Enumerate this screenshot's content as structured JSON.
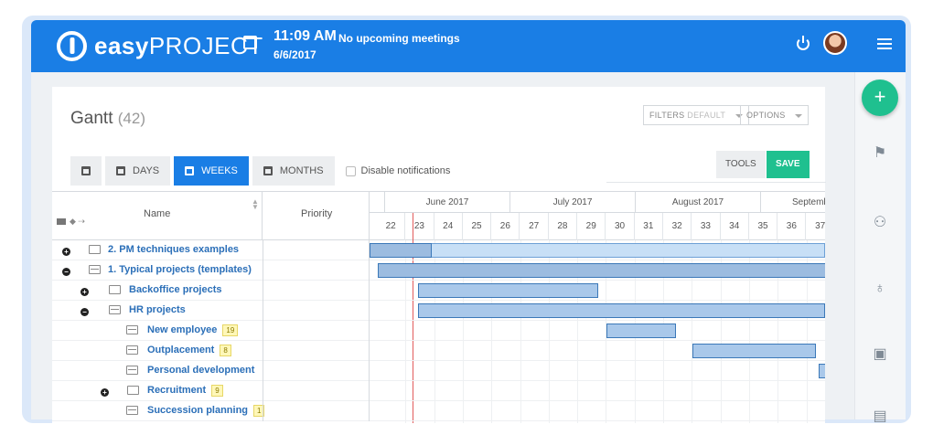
{
  "header": {
    "logo_bold": "easy",
    "logo_rest": "PROJECT",
    "time": "11:09 AM",
    "meetings": "No upcoming meetings",
    "date": "6/6/2017"
  },
  "page": {
    "title": "Gantt",
    "count": "(42)",
    "filters_label": "FILTERS",
    "filters_value": "DEFAULT",
    "options_label": "OPTIONS",
    "tools_label": "TOOLS",
    "save_label": "SAVE"
  },
  "toolbar": {
    "days": "DAYS",
    "weeks": "WEEKS",
    "months": "MONTHS",
    "disable_notifications": "Disable notifications"
  },
  "grid": {
    "col_name": "Name",
    "col_priority": "Priority",
    "months": [
      "June 2017",
      "July 2017",
      "August 2017",
      "Septemb"
    ],
    "weeks": [
      "22",
      "23",
      "24",
      "25",
      "26",
      "27",
      "28",
      "29",
      "30",
      "31",
      "32",
      "33",
      "34",
      "35",
      "36",
      "37"
    ]
  },
  "rows": [
    {
      "label": "2. PM techniques examples",
      "badge": null,
      "toggle": "+"
    },
    {
      "label": "1. Typical projects (templates)",
      "badge": null,
      "toggle": "−"
    },
    {
      "label": "Backoffice projects",
      "badge": null,
      "toggle": "+"
    },
    {
      "label": "HR projects",
      "badge": null,
      "toggle": "−"
    },
    {
      "label": "New employee",
      "badge": "19",
      "toggle": null
    },
    {
      "label": "Outplacement",
      "badge": "8",
      "toggle": null
    },
    {
      "label": "Personal development",
      "badge": null,
      "toggle": null
    },
    {
      "label": "Recruitment",
      "badge": "9",
      "toggle": "+"
    },
    {
      "label": "Succession planning",
      "badge": "1",
      "toggle": null
    }
  ],
  "colors": {
    "brand": "#1a7ee5",
    "save": "#1fc08f",
    "today_line": "#e25b5b",
    "link": "#2b6fb8"
  }
}
